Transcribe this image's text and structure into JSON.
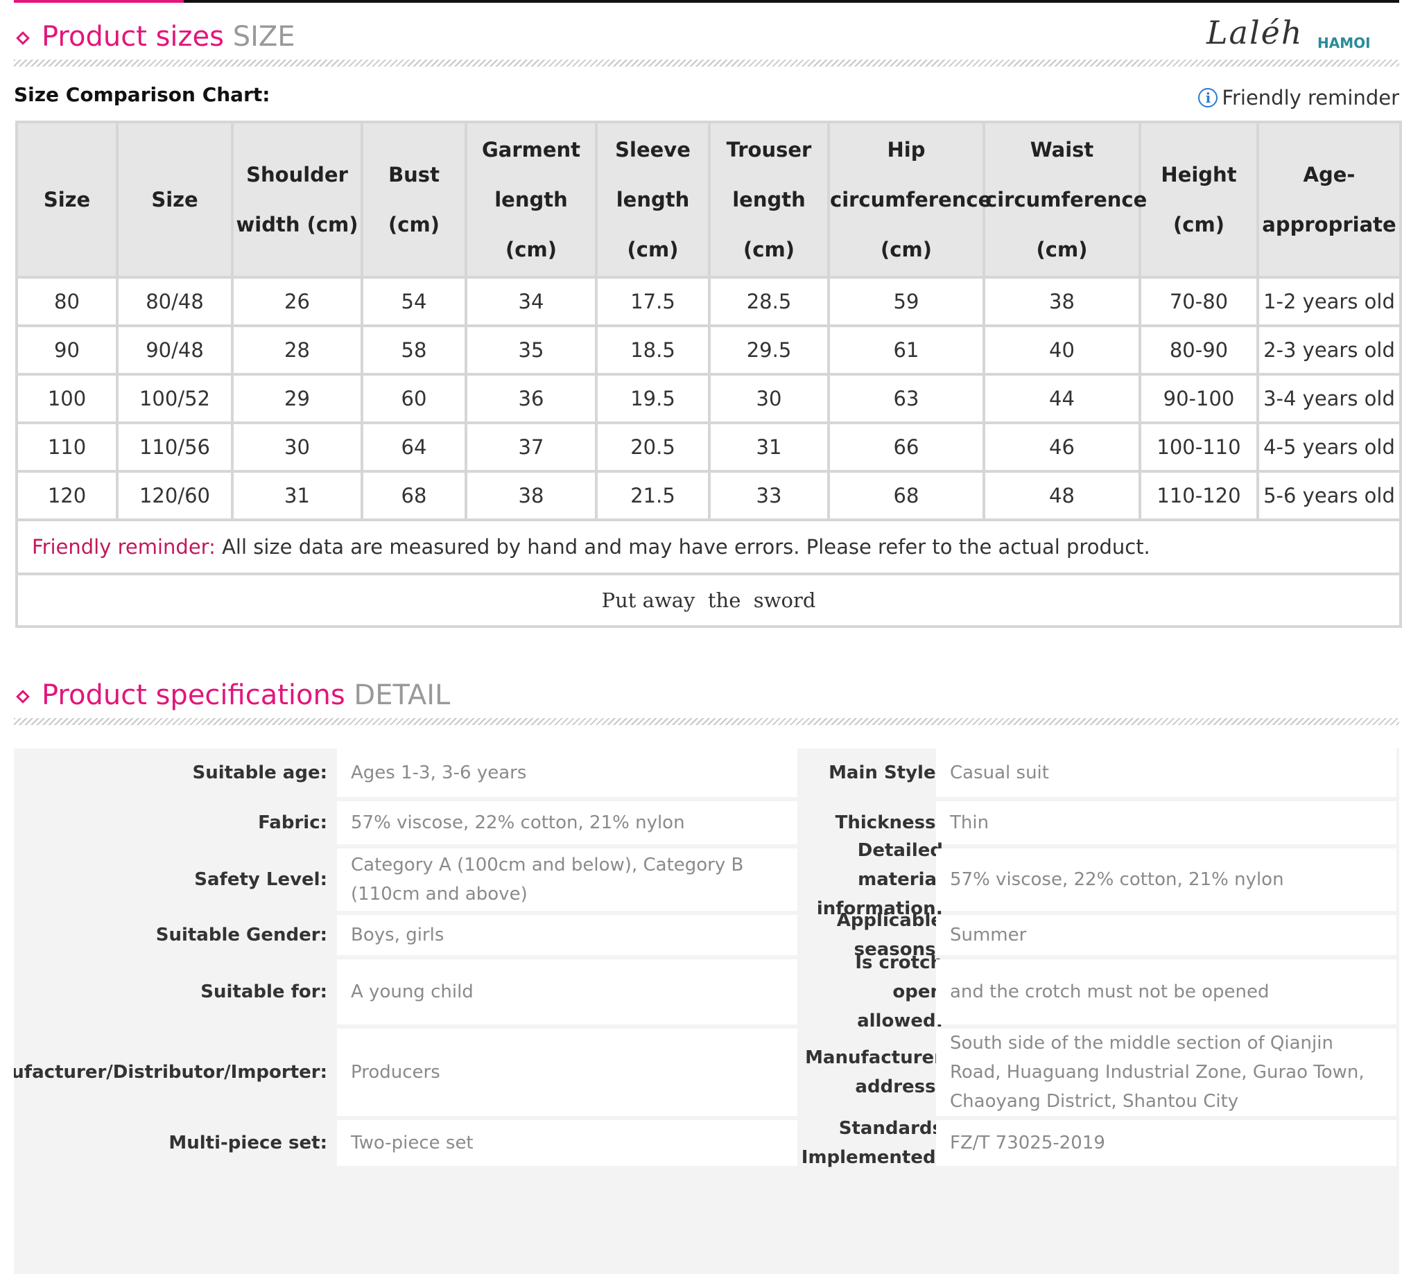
{
  "sizes_section": {
    "title": "Product sizes",
    "subtitle": "SIZE"
  },
  "brand": {
    "signature": "Laléh",
    "logo": "HAMOI"
  },
  "chart_label": "Size Comparison Chart:",
  "reminder_link": "Friendly reminder",
  "chart_data": {
    "type": "table",
    "columns": [
      "Size",
      "Size",
      "Shoulder width (cm)",
      "Bust (cm)",
      "Garment length (cm)",
      "Sleeve length (cm)",
      "Trouser length (cm)",
      "Hip circumference (cm)",
      "Waist circumference (cm)",
      "Height (cm)",
      "Age-appropriate"
    ],
    "rows": [
      [
        "80",
        "80/48",
        "26",
        "54",
        "34",
        "17.5",
        "28.5",
        "59",
        "38",
        "70-80",
        "1-2 years old"
      ],
      [
        "90",
        "90/48",
        "28",
        "58",
        "35",
        "18.5",
        "29.5",
        "61",
        "40",
        "80-90",
        "2-3 years old"
      ],
      [
        "100",
        "100/52",
        "29",
        "60",
        "36",
        "19.5",
        "30",
        "63",
        "44",
        "90-100",
        "3-4 years old"
      ],
      [
        "110",
        "110/56",
        "30",
        "64",
        "37",
        "20.5",
        "31",
        "66",
        "46",
        "100-110",
        "4-5 years old"
      ],
      [
        "120",
        "120/60",
        "31",
        "68",
        "38",
        "21.5",
        "33",
        "68",
        "48",
        "110-120",
        "5-6 years old"
      ]
    ]
  },
  "table_note": {
    "label": "Friendly reminder:",
    "text": " All size data are measured by hand and may have errors. Please refer to the actual product."
  },
  "table_footer": "Put away  the  sword",
  "detail_section": {
    "title": "Product specifications",
    "subtitle": "DETAIL"
  },
  "specs": [
    {
      "k1": "Suitable age:",
      "v1": "Ages 1-3, 3-6 years",
      "k2": "Main Style:",
      "v2": "Casual suit"
    },
    {
      "k1": "Fabric:",
      "v1": "57% viscose, 22% cotton, 21% nylon",
      "k2": "Thickness:",
      "v2": "Thin"
    },
    {
      "k1": "Safety Level:",
      "v1": "Category A (100cm and below), Category B (110cm and above)",
      "k2": "Detailed material information:",
      "v2": "57% viscose, 22% cotton, 21% nylon"
    },
    {
      "k1": "Suitable Gender:",
      "v1": "Boys, girls",
      "k2": "Applicable seasons:",
      "v2": "Summer"
    },
    {
      "k1": "Suitable for:",
      "v1": "A young child",
      "k2": "Is crotch open allowed:",
      "v2": "and the crotch must not be opened"
    },
    {
      "k1": "Manufacturer/Distributor/Importer:",
      "v1": "Producers",
      "k2": "Manufacturer address:",
      "v2": "South side of the middle section of Qianjin Road, Huaguang Industrial Zone, Gurao Town, Chaoyang District, Shantou City"
    },
    {
      "k1": "Multi-piece set:",
      "v1": "Two-piece set",
      "k2": "Standards Implemented:",
      "v2": "FZ/T 73025-2019"
    }
  ]
}
